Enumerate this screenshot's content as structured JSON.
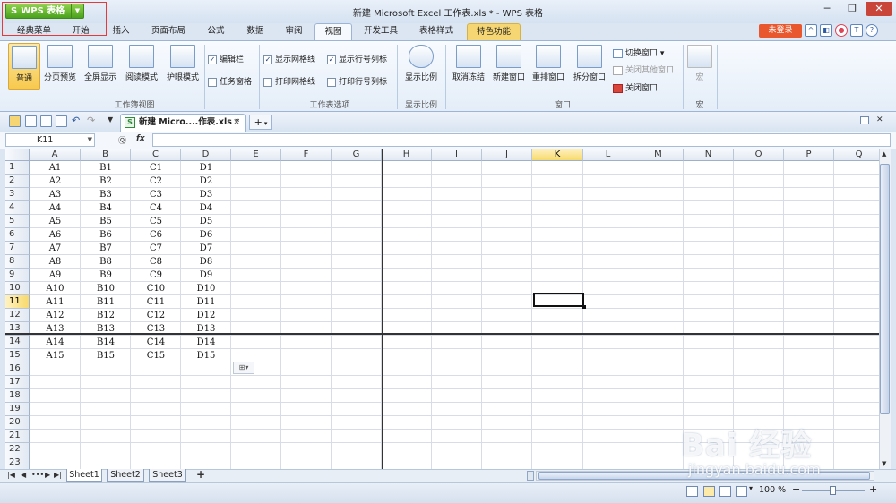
{
  "app": {
    "button_label": "WPS 表格",
    "window_title": "新建 Microsoft Excel 工作表.xls * - WPS 表格"
  },
  "menu": {
    "tabs": [
      "经典菜单",
      "开始",
      "插入",
      "页面布局",
      "公式",
      "数据",
      "审阅",
      "视图",
      "开发工具",
      "表格样式",
      "特色功能"
    ],
    "active": "视图",
    "login_label": "未登录"
  },
  "ribbon": {
    "workbook_view": {
      "buttons": [
        "普通",
        "分页预览",
        "全屏显示",
        "阅读模式",
        "护眼模式"
      ],
      "group_label": "工作簿视图"
    },
    "show": {
      "checkboxes": [
        {
          "label": "编辑栏",
          "checked": true
        },
        {
          "label": "任务窗格",
          "checked": false
        },
        {
          "label": "显示网格线",
          "checked": true
        },
        {
          "label": "打印网格线",
          "checked": false
        },
        {
          "label": "显示行号列标",
          "checked": true
        },
        {
          "label": "打印行号列标",
          "checked": false
        }
      ],
      "group_label": "工作表选项"
    },
    "zoom": {
      "button": "显示比例",
      "group_label": "显示比例"
    },
    "window": {
      "buttons": [
        "取消冻结",
        "新建窗口",
        "重排窗口",
        "拆分窗口"
      ],
      "small": [
        {
          "label": "切换窗口",
          "enabled": true
        },
        {
          "label": "关闭其他窗口",
          "enabled": false
        },
        {
          "label": "关闭窗口",
          "enabled": true
        }
      ],
      "group_label": "窗口"
    },
    "macro": {
      "button": "宏",
      "group_label": "宏"
    }
  },
  "doc_tab": {
    "label": "新建 Micro....作表.xls *",
    "close": "×",
    "new": "+"
  },
  "formula_bar": {
    "name_box": "K11",
    "fx": "fx",
    "content": ""
  },
  "sheet": {
    "columns": [
      "A",
      "B",
      "C",
      "D",
      "E",
      "F",
      "G",
      "H",
      "I",
      "J",
      "K",
      "L",
      "M",
      "N",
      "O",
      "P",
      "Q"
    ],
    "selected_col": "K",
    "selected_row": "11",
    "rows": [
      "1",
      "2",
      "3",
      "4",
      "5",
      "6",
      "7",
      "8",
      "9",
      "10",
      "11",
      "12",
      "13",
      "14",
      "15",
      "16",
      "17",
      "18",
      "19",
      "20",
      "21",
      "22",
      "23"
    ],
    "data": [
      [
        "A1",
        "B1",
        "C1",
        "D1"
      ],
      [
        "A2",
        "B2",
        "C2",
        "D2"
      ],
      [
        "A3",
        "B3",
        "C3",
        "D3"
      ],
      [
        "A4",
        "B4",
        "C4",
        "D4"
      ],
      [
        "A5",
        "B5",
        "C5",
        "D5"
      ],
      [
        "A6",
        "B6",
        "C6",
        "D6"
      ],
      [
        "A7",
        "B7",
        "C7",
        "D7"
      ],
      [
        "A8",
        "B8",
        "C8",
        "D8"
      ],
      [
        "A9",
        "B9",
        "C9",
        "D9"
      ],
      [
        "A10",
        "B10",
        "C10",
        "D10"
      ],
      [
        "A11",
        "B11",
        "C11",
        "D11"
      ],
      [
        "A12",
        "B12",
        "C12",
        "D12"
      ],
      [
        "A13",
        "B13",
        "C13",
        "D13"
      ],
      [
        "A14",
        "B14",
        "C14",
        "D14"
      ],
      [
        "A15",
        "B15",
        "C15",
        "D15"
      ]
    ]
  },
  "sheet_tabs": [
    "Sheet1",
    "Sheet2",
    "Sheet3"
  ],
  "add_sheet": "+",
  "status": {
    "zoom": "100 %"
  },
  "watermark": {
    "line1": "Bai 经验",
    "line2": "jingyan.baidu.com"
  }
}
